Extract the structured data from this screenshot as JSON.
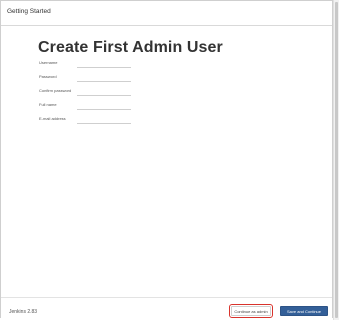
{
  "topbar": {
    "title": "Getting Started"
  },
  "page": {
    "title": "Create First Admin User"
  },
  "form": {
    "fields": [
      {
        "label": "Username",
        "value": ""
      },
      {
        "label": "Password",
        "value": ""
      },
      {
        "label": "Confirm password",
        "value": ""
      },
      {
        "label": "Full name",
        "value": ""
      },
      {
        "label": "E-mail address",
        "value": ""
      }
    ]
  },
  "footer": {
    "version": "Jenkins 2.83",
    "continue_admin_label": "Continue as admin",
    "save_label": "Save and Continue"
  }
}
